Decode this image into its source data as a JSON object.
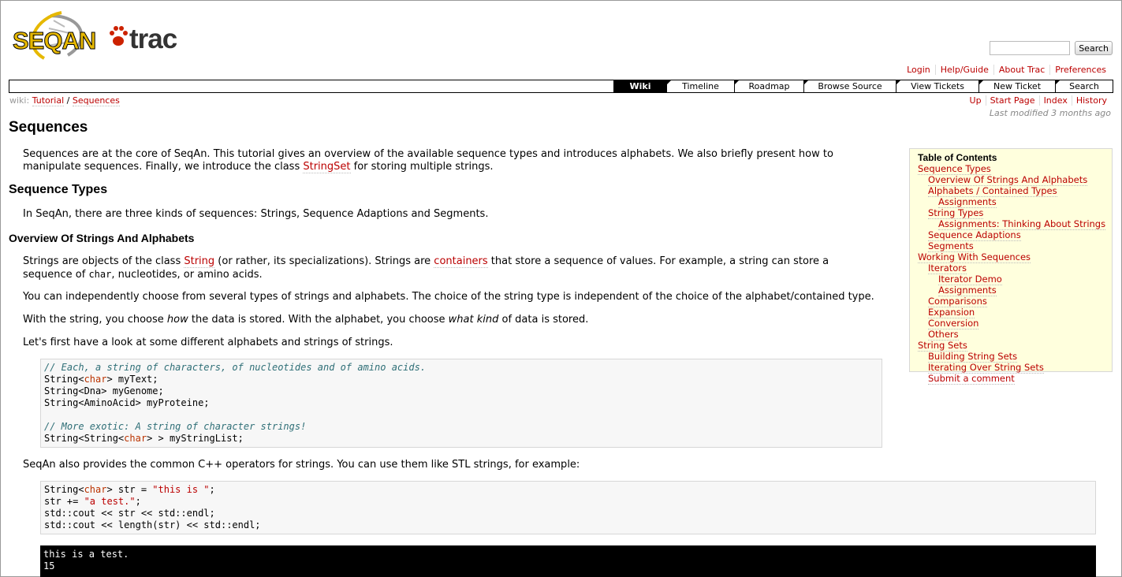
{
  "logo": {
    "text_left": "SEQAN",
    "text_right": "trac",
    "alt": "SeqAn"
  },
  "search": {
    "placeholder": "",
    "button_label": "Search"
  },
  "metanav": [
    "Login",
    "Help/Guide",
    "About Trac",
    "Preferences"
  ],
  "mainnav": [
    {
      "label": "Wiki",
      "active": true
    },
    {
      "label": "Timeline"
    },
    {
      "label": "Roadmap"
    },
    {
      "label": "Browse Source"
    },
    {
      "label": "View Tickets"
    },
    {
      "label": "New Ticket"
    },
    {
      "label": "Search"
    }
  ],
  "breadcrumb": {
    "prefix": "wiki:",
    "items": [
      "Tutorial",
      "Sequences"
    ],
    "sep": "/"
  },
  "ctxtnav": [
    "Up",
    "Start Page",
    "Index",
    "History"
  ],
  "last_modified": "Last modified 3 months ago",
  "page": {
    "title": "Sequences",
    "intro_a": "Sequences are at the core of SeqAn. This tutorial gives an overview of the available sequence types and introduces alphabets. We also briefly present how to",
    "intro_b_pre": "manipulate sequences. Finally, we introduce the class ",
    "intro_b_link": "StringSet",
    "intro_b_post": " for storing multiple strings.",
    "h_sequence_types": "Sequence Types",
    "p_kinds": "In SeqAn, there are three kinds of sequences: Strings, Sequence Adaptions and Segments.",
    "h_overview": "Overview Of Strings And Alphabets",
    "p_strings_1": "Strings are objects of the class ",
    "p_strings_link1": "String",
    "p_strings_2": " (or rather, its specializations). Strings are ",
    "p_strings_link2": "containers",
    "p_strings_3": " that store a sequence of values. For example, a string can store a",
    "p_strings_4": "sequence of ",
    "p_strings_code": "char",
    "p_strings_5": ", nucleotides, or amino acids.",
    "p_choose": "You can independently choose from several types of strings and alphabets. The choice of the string type is independent of the choice of the alphabet/contained type.",
    "p_how_1": "With the string, you choose ",
    "p_how_em1": "how",
    "p_how_2": " the data is stored. With the alphabet, you choose ",
    "p_how_em2": "what kind",
    "p_how_3": " of data is stored.",
    "p_first": "Let's first have a look at some different alphabets and strings of strings.",
    "p_cpp": "SeqAn also provides the common C++ operators for strings. You can use them like STL strings, for example:",
    "output_lines": [
      "this is a test.",
      "15"
    ]
  },
  "code1": {
    "c1": "// Each, a string of characters, of nucleotides and of amino acids.",
    "l1a": "String<",
    "l1k": "char",
    "l1b": "> myText;",
    "l2": "String<Dna> myGenome;",
    "l3": "String<AminoAcid> myProteine;",
    "c2": "// More exotic: A string of character strings!",
    "l4a": "String<String<",
    "l4k": "char",
    "l4b": "> > myStringList;"
  },
  "code2": {
    "l1a": "String<",
    "l1k": "char",
    "l1b": "> str = ",
    "l1s": "\"this is \"",
    "l1c": ";",
    "l2a": "str += ",
    "l2s": "\"a test.\"",
    "l2c": ";",
    "l3": "std::cout << str << std::endl;",
    "l4": "std::cout << length(str) << std::endl;"
  },
  "toc": {
    "title": "Table of Contents",
    "items": [
      {
        "label": "Sequence Types",
        "level": 1
      },
      {
        "label": "Overview Of Strings And Alphabets",
        "level": 2
      },
      {
        "label": "Alphabets / Contained Types",
        "level": 2
      },
      {
        "label": "Assignments",
        "level": 3
      },
      {
        "label": "String Types",
        "level": 2
      },
      {
        "label": "Assignments: Thinking About Strings",
        "level": 3
      },
      {
        "label": "Sequence Adaptions",
        "level": 2
      },
      {
        "label": "Segments",
        "level": 2
      },
      {
        "label": "Working With Sequences",
        "level": 1
      },
      {
        "label": "Iterators",
        "level": 2
      },
      {
        "label": "Iterator Demo",
        "level": 3
      },
      {
        "label": "Assignments",
        "level": 3
      },
      {
        "label": "Comparisons",
        "level": 2
      },
      {
        "label": "Expansion",
        "level": 2
      },
      {
        "label": "Conversion",
        "level": 2
      },
      {
        "label": "Others",
        "level": 2
      },
      {
        "label": "String Sets",
        "level": 1
      },
      {
        "label": "Building String Sets",
        "level": 2
      },
      {
        "label": "Iterating Over String Sets",
        "level": 2
      },
      {
        "label": "Submit a comment",
        "level": 2
      }
    ]
  },
  "colors": {
    "link": "#bb0000",
    "toc_bg": "#ffffdd",
    "nav_active": "#000000"
  }
}
